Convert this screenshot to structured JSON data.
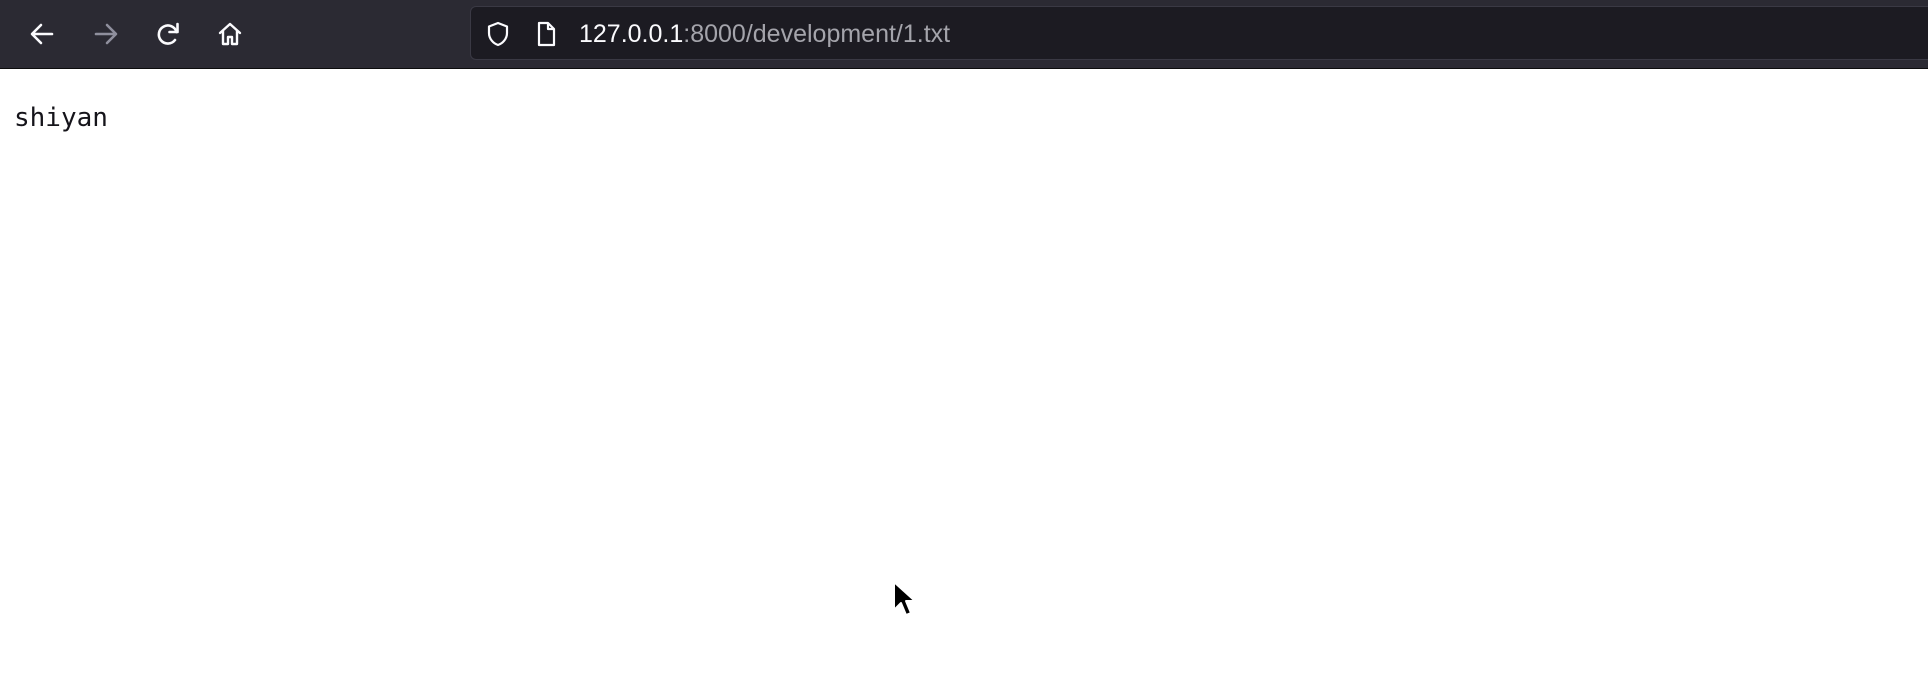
{
  "browser": {
    "back_icon": "arrow-left-icon",
    "forward_icon": "arrow-right-icon",
    "reload_icon": "reload-icon",
    "home_icon": "home-icon",
    "address_bar": {
      "shield_icon": "shield-icon",
      "page_icon": "page-icon",
      "host": "127.0.0.1",
      "rest": ":8000/development/1.txt"
    }
  },
  "page": {
    "text": "shiyan"
  },
  "colors": {
    "toolbar_bg": "#2b2a33",
    "urlbar_bg": "#1c1b22",
    "host_text": "#fbfbfe",
    "url_dim_text": "#a4a4ab"
  }
}
